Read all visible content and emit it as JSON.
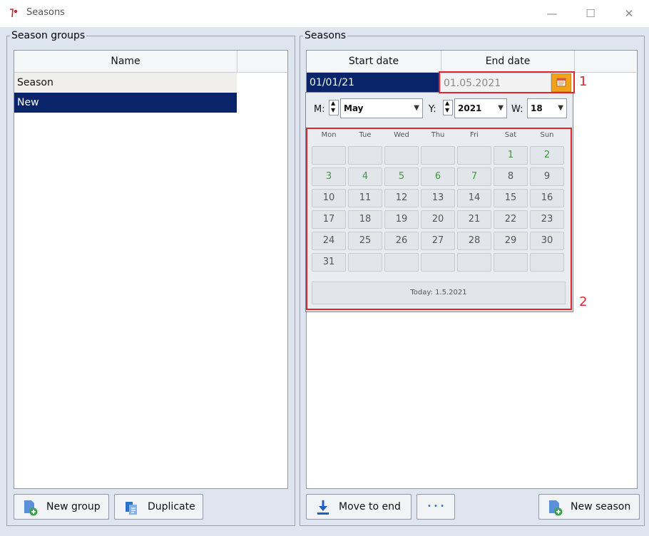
{
  "window": {
    "title": "Seasons",
    "minimize": "—",
    "maximize": "☐",
    "close": "✕"
  },
  "season_groups": {
    "label": "Season groups",
    "column_header": "Name",
    "rows": [
      {
        "name": "Season",
        "selected": false
      },
      {
        "name": "New",
        "selected": true
      }
    ],
    "buttons": {
      "new_group": "New group",
      "duplicate": "Duplicate"
    }
  },
  "seasons": {
    "label": "Seasons",
    "columns": {
      "start": "Start date",
      "end": "End date"
    },
    "row": {
      "start": "01/01/21",
      "end": "01.05.2021"
    },
    "buttons": {
      "move_to_end": "Move to end",
      "more": "• • •",
      "new_season": "New season"
    }
  },
  "calendar": {
    "month_label": "M:",
    "month": "May",
    "year_label": "Y:",
    "year": "2021",
    "week_label": "W:",
    "week": "18",
    "weekdays": [
      "Mon",
      "Tue",
      "Wed",
      "Thu",
      "Fri",
      "Sat",
      "Sun"
    ],
    "days": [
      "",
      "",
      "",
      "",
      "",
      "1",
      "2",
      "3",
      "4",
      "5",
      "6",
      "7",
      "8",
      "9",
      "10",
      "11",
      "12",
      "13",
      "14",
      "15",
      "16",
      "17",
      "18",
      "19",
      "20",
      "21",
      "22",
      "23",
      "24",
      "25",
      "26",
      "27",
      "28",
      "29",
      "30",
      "31",
      "",
      "",
      "",
      "",
      "",
      ""
    ],
    "highlighted_days": [
      "1",
      "2",
      "3",
      "4",
      "5",
      "6",
      "7"
    ],
    "today_label": "Today: 1.5.2021"
  },
  "annotations": {
    "callout_1": "1",
    "callout_2": "2"
  },
  "colors": {
    "selection": "#0a246a",
    "highlight_day": "#3e9a3e",
    "annotation": "#e0252b",
    "calendar_button": "#f2a21b"
  }
}
